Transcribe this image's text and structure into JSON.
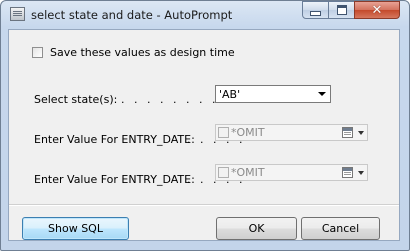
{
  "window": {
    "title": "select state and date - AutoPrompt"
  },
  "form": {
    "save_design_time_label": "Save these values as design time",
    "state_label": "Select state(s):",
    "state_dots": ". . . . . . . . . . . .",
    "state_value": "'AB'",
    "entry_date_1_label": "Enter Value For ENTRY_DATE:",
    "entry_date_1_dots": ". . . . .",
    "entry_date_1_value": "*OMIT",
    "entry_date_2_label": "Enter Value For ENTRY_DATE:",
    "entry_date_2_dots": ". . . . .",
    "entry_date_2_value": "*OMIT"
  },
  "buttons": {
    "show_sql": "Show SQL",
    "ok": "OK",
    "cancel": "Cancel"
  }
}
